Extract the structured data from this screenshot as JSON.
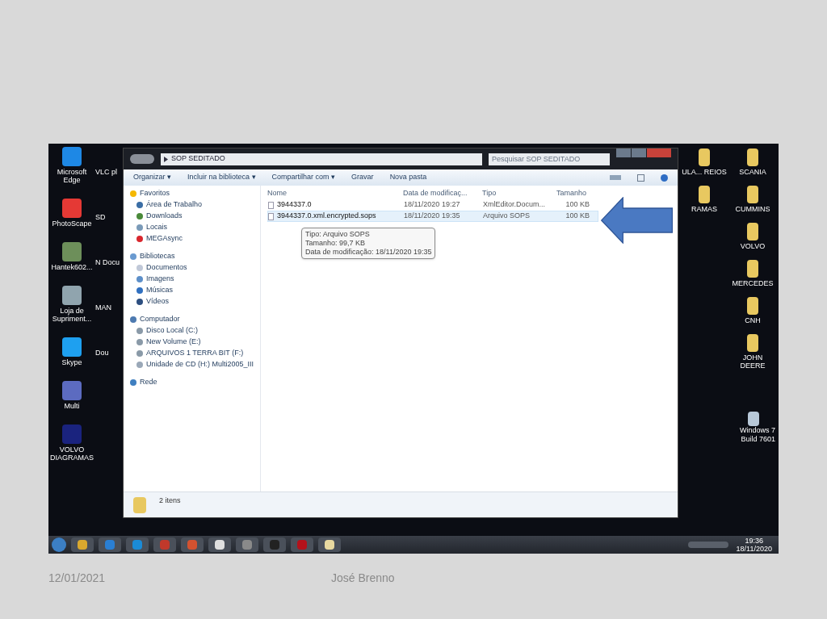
{
  "desktop": {
    "left_icons": [
      {
        "label": "Microsoft Edge",
        "kind": "edge"
      },
      {
        "label": "PhotoScape",
        "kind": "photoscape"
      },
      {
        "label": "Hantek602...",
        "kind": "monitor"
      },
      {
        "label": "Loja de Supriment...",
        "kind": "printer"
      },
      {
        "label": "Skype",
        "kind": "skype"
      },
      {
        "label": "Multi",
        "kind": "tools"
      },
      {
        "label": "VOLVO DIAGRAMAS",
        "kind": "volvo"
      }
    ],
    "covered_icons": [
      "VLC pl",
      "SD",
      "N Docu",
      "MAN",
      "Dou"
    ],
    "right_icons": [
      {
        "label": "ULA... REIOS",
        "kind": "folder"
      },
      {
        "label": "SCANIA",
        "kind": "folder"
      },
      {
        "label": "RAMAS",
        "kind": "folder"
      },
      {
        "label": "CUMMINS",
        "kind": "folder"
      },
      {
        "label": "VOLVO",
        "kind": "folder"
      },
      {
        "label": "MERCEDES",
        "kind": "folder"
      },
      {
        "label": "CNH",
        "kind": "folder"
      },
      {
        "label": "JOHN DEERE",
        "kind": "folder"
      }
    ],
    "watermark_lines": [
      "Windows 7",
      "Build 7601"
    ]
  },
  "window": {
    "breadcrumb": "SOP SEDITADO",
    "search": {
      "placeholder": "Pesquisar SOP SEDITADO"
    },
    "toolbar": [
      "Organizar ▾",
      "Incluir na biblioteca ▾",
      "Compartilhar com ▾",
      "Gravar",
      "Nova pasta"
    ],
    "nav": [
      {
        "label": "Favoritos",
        "kind": "star",
        "children": [
          {
            "label": "Área de Trabalho",
            "kind": "desktop"
          },
          {
            "label": "Downloads",
            "kind": "download"
          },
          {
            "label": "Locais",
            "kind": "places"
          },
          {
            "label": "MEGAsync",
            "kind": "mega"
          }
        ]
      },
      {
        "label": "Bibliotecas",
        "kind": "library",
        "children": [
          {
            "label": "Documentos",
            "kind": "doc"
          },
          {
            "label": "Imagens",
            "kind": "image"
          },
          {
            "label": "Músicas",
            "kind": "music"
          },
          {
            "label": "Vídeos",
            "kind": "video"
          }
        ]
      },
      {
        "label": "Computador",
        "kind": "computer",
        "children": [
          {
            "label": "Disco Local (C:)",
            "kind": "drive"
          },
          {
            "label": "New Volume (E:)",
            "kind": "drive"
          },
          {
            "label": "ARQUIVOS 1 TERRA BIT (F:)",
            "kind": "drive"
          },
          {
            "label": "Unidade de CD (H:) Multi2005_III",
            "kind": "cd"
          }
        ]
      },
      {
        "label": "Rede",
        "kind": "network"
      }
    ],
    "columns": [
      "Nome",
      "Data de modificaç...",
      "Tipo",
      "Tamanho"
    ],
    "rows": [
      {
        "name": "3944337.0",
        "date": "18/11/2020 19:27",
        "type": "XmlEditor.Docum...",
        "size": "100 KB",
        "selected": false
      },
      {
        "name": "3944337.0.xml.encrypted.sops",
        "date": "18/11/2020 19:35",
        "type": "Arquivo SOPS",
        "size": "100 KB",
        "selected": true
      }
    ],
    "tooltip": [
      "Tipo: Arquivo SOPS",
      "Tamanho: 99,7 KB",
      "Data de modificação: 18/11/2020 19:35"
    ],
    "status": "2 itens"
  },
  "taskbar": {
    "time": "19:36",
    "date": "18/11/2020"
  },
  "footer": {
    "date": "12/01/2021",
    "author": "José Brenno"
  }
}
